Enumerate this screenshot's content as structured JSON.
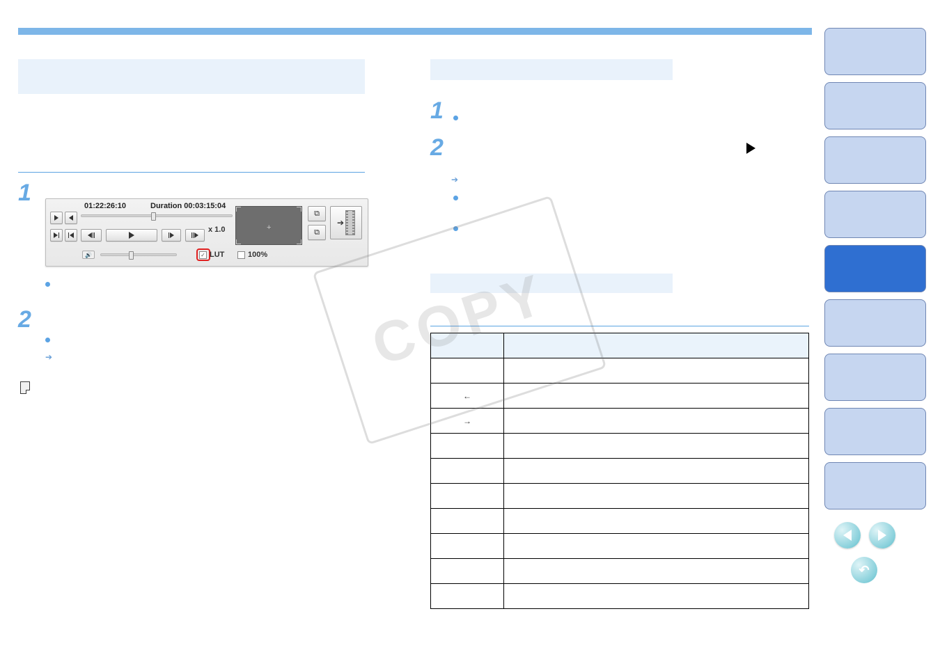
{
  "topbar": {},
  "left": {
    "step1_num": "1",
    "step2_num": "2"
  },
  "right": {
    "step1_num": "1",
    "step2_num": "2"
  },
  "panel": {
    "timecode": "01:22:26:10",
    "duration_label": "Duration 00:03:15:04",
    "speed": "x 1.0",
    "lut_label": "LUT",
    "lut_checked": "✓",
    "hundred_label": "100%"
  },
  "table": {
    "header_key": "",
    "header_op": "",
    "rows": [
      {
        "k": "",
        "op": ""
      },
      {
        "k": "←",
        "op": ""
      },
      {
        "k": "→",
        "op": ""
      },
      {
        "k": "",
        "op": ""
      },
      {
        "k": "",
        "op": ""
      },
      {
        "k": "",
        "op": ""
      },
      {
        "k": "",
        "op": ""
      },
      {
        "k": "",
        "op": ""
      },
      {
        "k": "",
        "op": ""
      },
      {
        "k": "",
        "op": ""
      }
    ]
  },
  "sidebar": {
    "tab_count": 9,
    "active_index": 4
  }
}
